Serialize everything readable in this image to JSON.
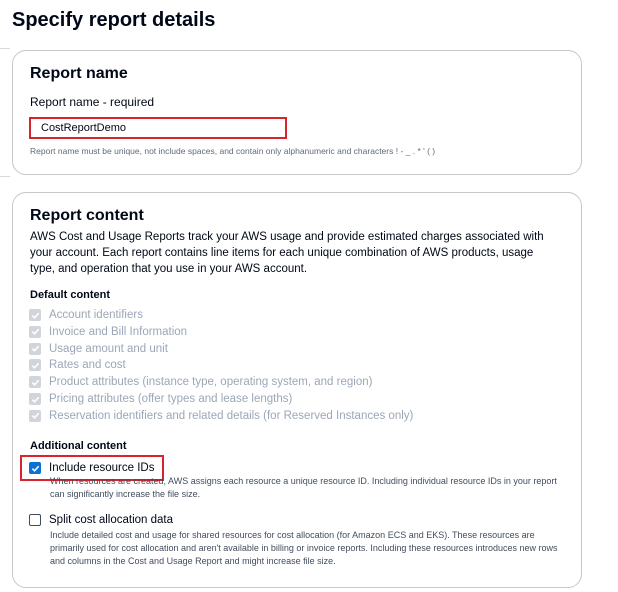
{
  "page": {
    "title": "Specify report details"
  },
  "report_name": {
    "heading": "Report name",
    "label": "Report name - required",
    "value": "CostReportDemo",
    "constraint": "Report name must be unique, not include spaces, and contain only alphanumeric and characters ! - _ . * ' ( )"
  },
  "report_content": {
    "heading": "Report content",
    "description": "AWS Cost and Usage Reports track your AWS usage and provide estimated charges associated with your account. Each report contains line items for each unique combination of AWS products, usage type, and operation that you use in your AWS account.",
    "default_heading": "Default content",
    "default_items": [
      "Account identifiers",
      "Invoice and Bill Information",
      "Usage amount and unit",
      "Rates and cost",
      "Product attributes (instance type, operating system, and region)",
      "Pricing attributes (offer types and lease lengths)",
      "Reservation identifiers and related details (for Reserved Instances only)"
    ],
    "additional_heading": "Additional content",
    "include_resource_ids": {
      "label": "Include resource IDs",
      "checked": true,
      "description": "When resources are created, AWS assigns each resource a unique resource ID. Including individual resource IDs in your report can significantly increase the file size."
    },
    "split_cost": {
      "label": "Split cost allocation data",
      "checked": false,
      "description": "Include detailed cost and usage for shared resources for cost allocation (for Amazon ECS and EKS). These resources are primarily used for cost allocation and aren't available in billing or invoice reports. Including these resources introduces new rows and columns in the Cost and Usage Report and might increase file size."
    }
  },
  "colors": {
    "accent": "#0972d3",
    "highlight": "#d9232d",
    "disabled": "#9ba7b6"
  }
}
